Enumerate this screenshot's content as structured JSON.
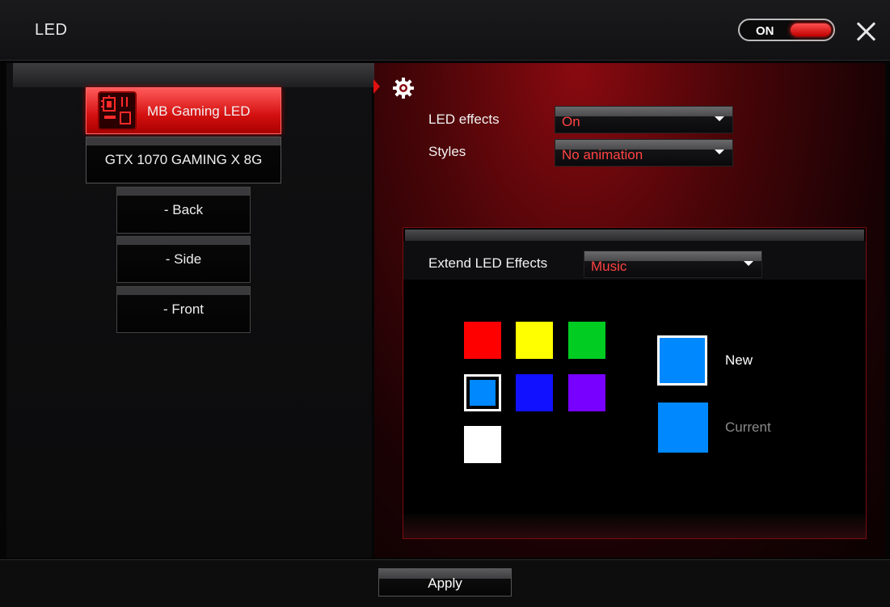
{
  "window": {
    "title": "LED"
  },
  "power_toggle": {
    "label": "ON",
    "state": "on"
  },
  "devices": [
    {
      "label": "MB Gaming LED",
      "icon": "motherboard-chip-icon",
      "active": true
    },
    {
      "label": "GTX 1070 GAMING X 8G",
      "active": false
    }
  ],
  "zones": [
    {
      "label": "- Back"
    },
    {
      "label": "- Side"
    },
    {
      "label": "- Front"
    }
  ],
  "settings": {
    "led_effects": {
      "label": "LED effects",
      "value": "On"
    },
    "styles": {
      "label": "Styles",
      "value": "No animation"
    }
  },
  "extend": {
    "label": "Extend LED Effects",
    "value": "Music",
    "palette": [
      {
        "name": "red",
        "color": "#ff0000"
      },
      {
        "name": "yellow",
        "color": "#ffff00"
      },
      {
        "name": "green",
        "color": "#00cc22"
      },
      {
        "name": "light-blue",
        "color": "#0088ff",
        "selected": true
      },
      {
        "name": "blue",
        "color": "#1111ff"
      },
      {
        "name": "purple",
        "color": "#7700ff"
      },
      {
        "name": "white",
        "color": "#ffffff"
      }
    ],
    "new": {
      "label": "New",
      "color": "#0088ff"
    },
    "current": {
      "label": "Current",
      "color": "#0088ff"
    }
  },
  "footer": {
    "apply_label": "Apply"
  },
  "colors": {
    "accent": "#ff4242",
    "active_device": "#d41010"
  }
}
